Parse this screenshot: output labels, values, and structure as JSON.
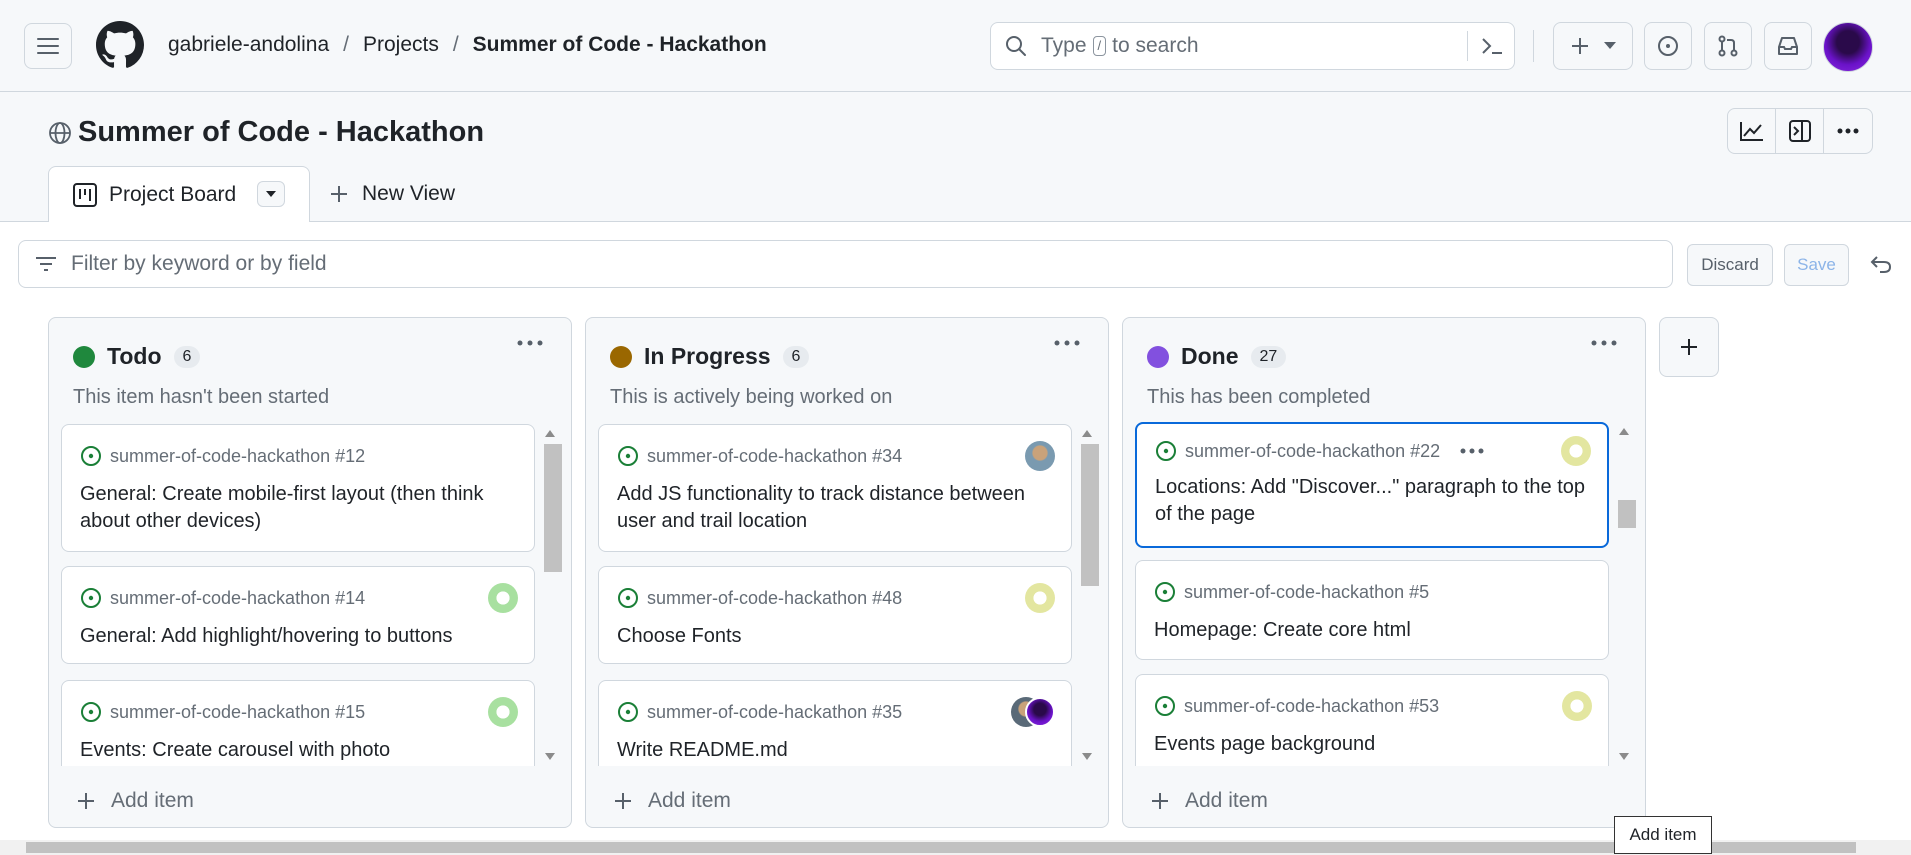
{
  "breadcrumb": {
    "owner": "gabriele-andolina",
    "sep": "/",
    "section": "Projects",
    "project": "Summer of Code - Hackathon"
  },
  "search": {
    "prefix": "Type",
    "key": "/",
    "suffix": "to search"
  },
  "project": {
    "title": "Summer of Code - Hackathon"
  },
  "tabs": {
    "active": "Project Board",
    "new_view": "New View"
  },
  "filter": {
    "placeholder": "Filter by keyword or by field",
    "discard": "Discard",
    "save": "Save"
  },
  "colors": {
    "todo": "#1f883d",
    "in_progress": "#9a6700",
    "done": "#8250df",
    "accent": "#0969da",
    "issue_open": "#1a7f37"
  },
  "columns": [
    {
      "title": "Todo",
      "count": "6",
      "desc": "This item hasn't been started",
      "cards": [
        {
          "ref": "summer-of-code-hackathon #12",
          "title": "General: Create mobile-first layout (then think about other devices)"
        },
        {
          "ref": "summer-of-code-hackathon #14",
          "title": "General: Add highlight/hovering to buttons"
        },
        {
          "ref": "summer-of-code-hackathon #15",
          "title": "Events: Create carousel with photo"
        }
      ],
      "add": "Add item"
    },
    {
      "title": "In Progress",
      "count": "6",
      "desc": "This is actively being worked on",
      "cards": [
        {
          "ref": "summer-of-code-hackathon #34",
          "title": "Add JS functionality to track distance between user and trail location"
        },
        {
          "ref": "summer-of-code-hackathon #48",
          "title": "Choose Fonts"
        },
        {
          "ref": "summer-of-code-hackathon #35",
          "title": "Write README.md"
        }
      ],
      "add": "Add item"
    },
    {
      "title": "Done",
      "count": "27",
      "desc": "This has been completed",
      "cards": [
        {
          "ref": "summer-of-code-hackathon #22",
          "title": "Locations: Add \"Discover...\" paragraph to the top of the page"
        },
        {
          "ref": "summer-of-code-hackathon #5",
          "title": "Homepage: Create core html"
        },
        {
          "ref": "summer-of-code-hackathon #53",
          "title": "Events page background"
        }
      ],
      "add": "Add item"
    }
  ],
  "tooltip": "Add item"
}
